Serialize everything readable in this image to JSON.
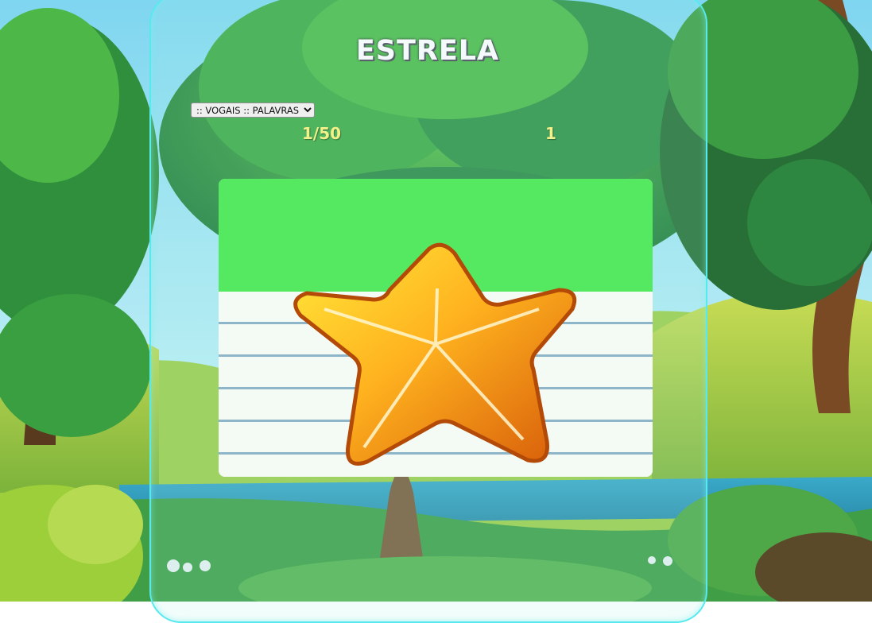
{
  "game": {
    "word": "ESTRELA",
    "mode_select": {
      "selected": ":: VOGAIS :: PALAVRAS",
      "options": [
        ":: VOGAIS :: PALAVRAS"
      ]
    },
    "progress": "1/50",
    "score": "1",
    "image_icon": "star-icon"
  },
  "colors": {
    "panel_border": "#57e9ee",
    "card_header": "#55e962",
    "ruled_line": "#8fb5c9",
    "counter_text": "#f3f08a"
  }
}
